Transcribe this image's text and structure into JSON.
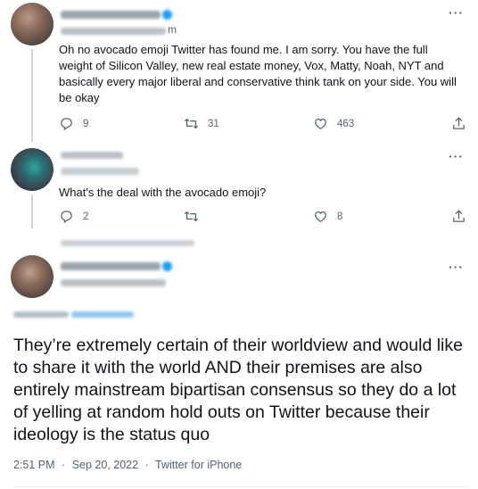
{
  "tweets": [
    {
      "text": "Oh no avocado emoji Twitter has found me. I am sorry. You have the full weight of Silicon Valley, new real estate money, Vox, Matty, Noah, NYT and basically every major liberal and conservative think tank on your side. You will be okay",
      "handle_fragment": "m",
      "replies": "9",
      "retweets": "31",
      "likes": "463"
    },
    {
      "text": "What's the deal with the avocado emoji?",
      "replies": "2",
      "retweets": "",
      "likes": "8"
    }
  ],
  "main_tweet": {
    "text": "They’re extremely certain of their worldview and would like to share it with the world AND their premises are also entirely mainstream bipartisan consensus so they do a lot of yelling at random hold outs on Twitter because their ideology is the status quo",
    "time": "2:51 PM",
    "date": "Sep 20, 2022",
    "source": "Twitter for iPhone",
    "separator": "·"
  },
  "more_label": "···",
  "colors": {
    "text": "#0f1419",
    "muted": "#536471",
    "verified": "#1d9bf0",
    "divider": "#eff3f4"
  },
  "icons": [
    "reply-icon",
    "retweet-icon",
    "like-icon",
    "share-icon",
    "more-icon",
    "verified-badge-icon"
  ]
}
